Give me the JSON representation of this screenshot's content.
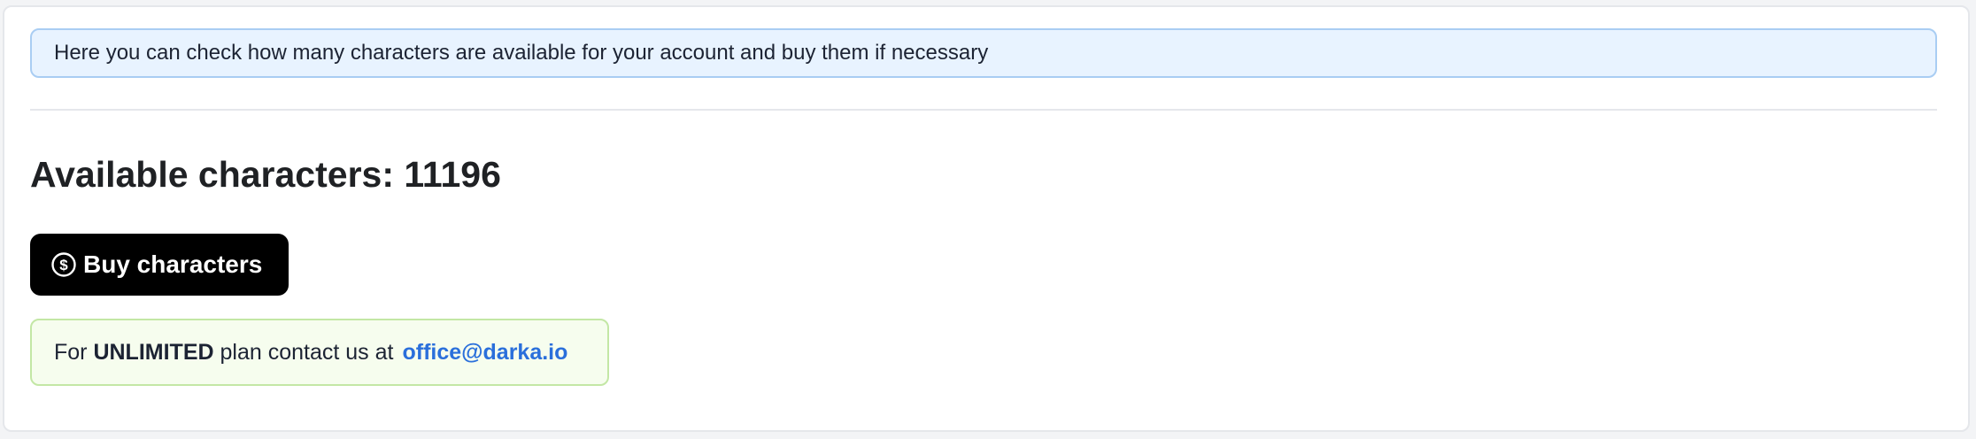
{
  "info_banner": {
    "text": "Here you can check how many characters are available for your account and buy them if necessary"
  },
  "available": {
    "label": "Available characters:",
    "count": "11196"
  },
  "buy_button": {
    "label": "Buy characters",
    "icon": "dollar-circle-icon"
  },
  "plan_note": {
    "prefix": "For ",
    "plan": "UNLIMITED",
    "middle": " plan contact us at",
    "email": "office@darka.io"
  },
  "colors": {
    "banner_bg": "#e8f3ff",
    "banner_border": "#a9cdf3",
    "button_bg": "#000000",
    "plan_bg": "#f6fdee",
    "plan_border": "#c3e7a5",
    "link": "#2a6fdb"
  }
}
